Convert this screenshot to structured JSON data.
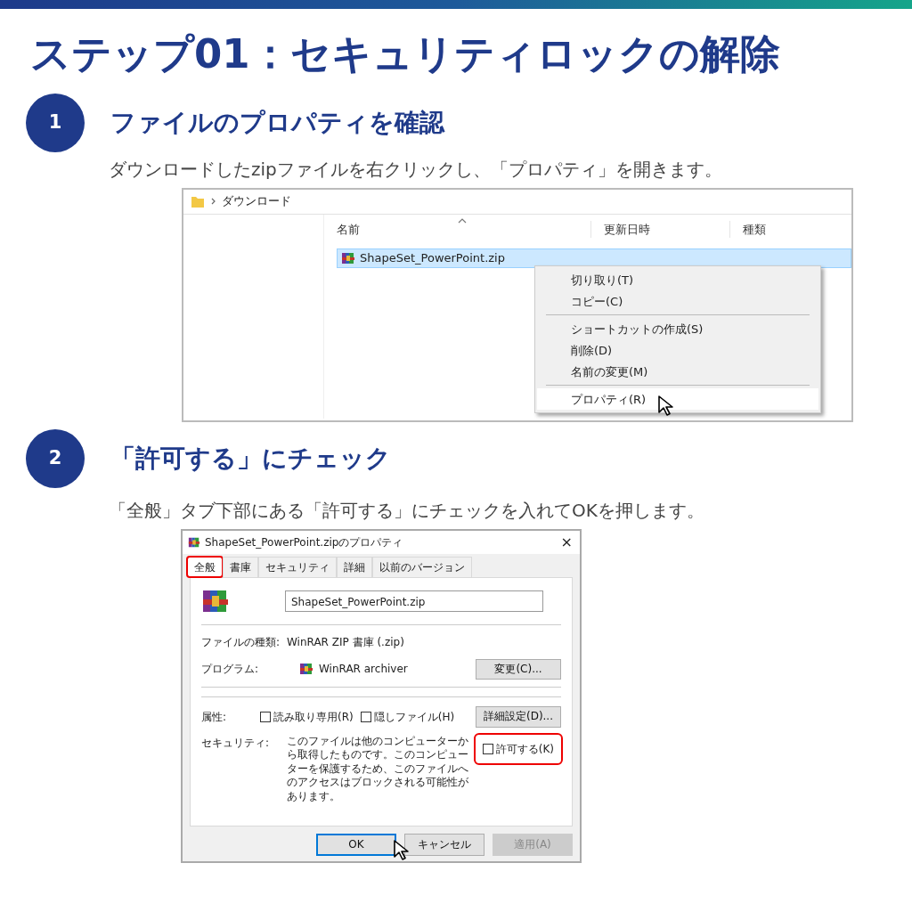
{
  "title": "ステップ01：セキュリティロックの解除",
  "steps": [
    {
      "number": "1",
      "heading": "ファイルのプロパティを確認",
      "description": "ダウンロードしたzipファイルを右クリックし、「プロパティ」を開きます。",
      "screenshot": {
        "kind": "explorer",
        "breadcrumb": "ダウンロード",
        "columns": [
          "名前",
          "更新日時",
          "種類"
        ],
        "file": {
          "name": "ShapeSet_PowerPoint.zip",
          "selected": true
        },
        "context_menu": [
          [
            {
              "label": "切り取り(T)",
              "selected": false
            },
            {
              "label": "コピー(C)",
              "selected": false
            }
          ],
          [
            {
              "label": "ショートカットの作成(S)",
              "selected": false
            },
            {
              "label": "削除(D)",
              "selected": false
            },
            {
              "label": "名前の変更(M)",
              "selected": false
            }
          ],
          [
            {
              "label": "プロパティ(R)",
              "selected": true
            }
          ]
        ]
      }
    },
    {
      "number": "2",
      "heading": "「許可する」にチェック",
      "description": "「全般」タブ下部にある「許可する」にチェックを入れてOKを押します。",
      "screenshot": {
        "kind": "properties",
        "title": "ShapeSet_PowerPoint.zipのプロパティ",
        "close": "×",
        "tabs": [
          {
            "label": "全般",
            "selected": true,
            "highlighted": true
          },
          {
            "label": "書庫",
            "selected": false,
            "highlighted": false
          },
          {
            "label": "セキュリティ",
            "selected": false,
            "highlighted": false
          },
          {
            "label": "詳細",
            "selected": false,
            "highlighted": false
          },
          {
            "label": "以前のバージョン",
            "selected": false,
            "highlighted": false
          }
        ],
        "filename": "ShapeSet_PowerPoint.zip",
        "file_type": {
          "label": "ファイルの種類:",
          "value": "WinRAR ZIP 書庫 (.zip)"
        },
        "program": {
          "label": "プログラム:",
          "value": "WinRAR archiver",
          "button": "変更(C)..."
        },
        "attributes": {
          "label": "属性:",
          "checkboxes": [
            {
              "label": "読み取り専用(R)",
              "checked": false
            },
            {
              "label": "隠しファイル(H)",
              "checked": false
            }
          ],
          "button": "詳細設定(D)..."
        },
        "security": {
          "label": "セキュリティ:",
          "text": "このファイルは他のコンピューターから取得したものです。このコンピューターを保護するため、このファイルへのアクセスはブロックされる可能性があります。",
          "checkbox": {
            "label": "許可する(K)",
            "checked": false,
            "highlighted": true
          }
        },
        "buttons": [
          {
            "label": "OK",
            "kind": "default",
            "disabled": false
          },
          {
            "label": "キャンセル",
            "kind": "normal",
            "disabled": false
          },
          {
            "label": "適用(A)",
            "kind": "normal",
            "disabled": true
          }
        ]
      }
    }
  ]
}
